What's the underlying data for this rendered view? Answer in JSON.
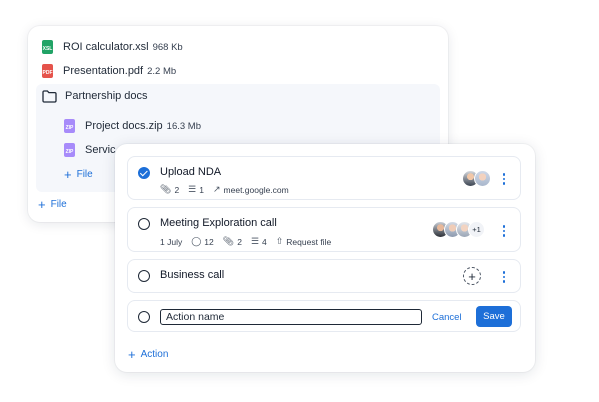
{
  "files_panel": {
    "files": [
      {
        "name": "ROI calculator.xsl",
        "size": "968 Kb",
        "icon": "xls-file-icon",
        "icon_label": "XSL"
      },
      {
        "name": "Presentation.pdf",
        "size": "2.2 Mb",
        "icon": "pdf-file-icon",
        "icon_label": "PDF"
      }
    ],
    "folder": {
      "name": "Partnership docs",
      "icon": "folder-icon",
      "files": [
        {
          "name": "Project docs.zip",
          "size": "16.3 Mb",
          "icon": "zip-file-icon",
          "icon_label": "ZIP"
        },
        {
          "name": "Servic",
          "size": "",
          "icon": "zip-file-icon",
          "icon_label": "ZIP"
        }
      ],
      "add_label": "File"
    },
    "add_label": "File"
  },
  "tasks_panel": {
    "tasks": [
      {
        "title": "Upload NDA",
        "done": true,
        "meta": {
          "attachments": "2",
          "subtasks": "1",
          "link": "meet.google.com"
        }
      },
      {
        "title": "Meeting Exploration call",
        "done": false,
        "meta": {
          "date": "1 July",
          "comments": "12",
          "attachments": "2",
          "subtasks": "4",
          "request": "Request file"
        },
        "more_count": "+1"
      },
      {
        "title": "Business call",
        "done": false
      }
    ],
    "new_task": {
      "placeholder": "Action name",
      "cancel_label": "Cancel",
      "save_label": "Save"
    },
    "add_label": "Action"
  },
  "colors": {
    "accent": "#1d6fd8",
    "xls": "#21a366",
    "pdf": "#e5534b",
    "zip": "#a78bfa"
  }
}
